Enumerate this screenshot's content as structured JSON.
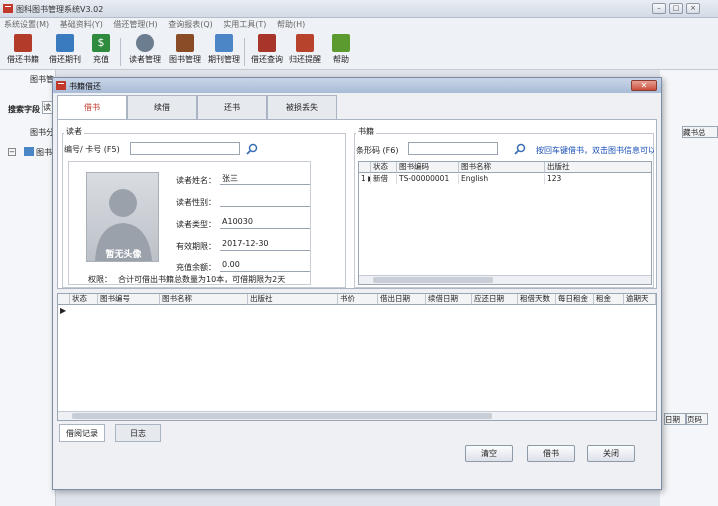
{
  "main": {
    "title": "图科图书管理系统V3.02",
    "menu": [
      "系统设置(M)",
      "基础资料(Y)",
      "借还管理(H)",
      "查询报表(Q)",
      "实用工具(T)",
      "帮助(H)"
    ],
    "toolbar": [
      "借还书籍",
      "借还期刊",
      "充值",
      "读者管理",
      "图书管理",
      "期刊管理",
      "借还查询",
      "归还提醒",
      "帮助"
    ],
    "bg_labels": {
      "tab": "图书管",
      "search": "搜索字段",
      "search_val": "读",
      "tree_title": "图书分",
      "tree_item": "图书",
      "right_header": "藏书总",
      "right_header2": "日期",
      "right_header3": "页码"
    }
  },
  "dialog": {
    "title": "书籍借还",
    "tabs": [
      "借书",
      "续借",
      "还书",
      "被损丢失"
    ],
    "reader": {
      "group_label": "读者",
      "id_label": "编号/ 卡号 (F5)",
      "name_label": "读者姓名：",
      "name_value": "张三",
      "gender_label": "读者性别：",
      "gender_value": "",
      "type_label": "读者类型：",
      "type_value": "A10030",
      "expiry_label": "有效期限：",
      "expiry_value": "2017-12-30",
      "balance_label": "充值余额：",
      "balance_value": "0.00",
      "photo_label": "暂无头像",
      "permission_label": "权限：",
      "permission_text": "合计可借出书籍总数量为10本，可借期限为2天"
    },
    "books": {
      "group_label": "书籍",
      "barcode_label": "条形码 (F6)",
      "hint": "按回车键借书，双击图书信息可以",
      "columns": [
        "状态",
        "图书编码",
        "图书名称",
        "出版社"
      ],
      "rows": [
        {
          "marker": "1 ▶",
          "status": "新借",
          "code": "TS-00000001",
          "name": "English",
          "publisher": "123"
        }
      ]
    },
    "records": {
      "columns": [
        "状态",
        "图书编号",
        "图书名称",
        "出版社",
        "书价",
        "借出日期",
        "续借日期",
        "应还日期",
        "租借天数",
        "每日租金",
        "租金",
        "逾期天"
      ]
    },
    "bottom_tabs": [
      "借阅记录",
      "日志"
    ],
    "buttons": {
      "clear": "清空",
      "borrow": "借书",
      "close": "关闭"
    }
  }
}
